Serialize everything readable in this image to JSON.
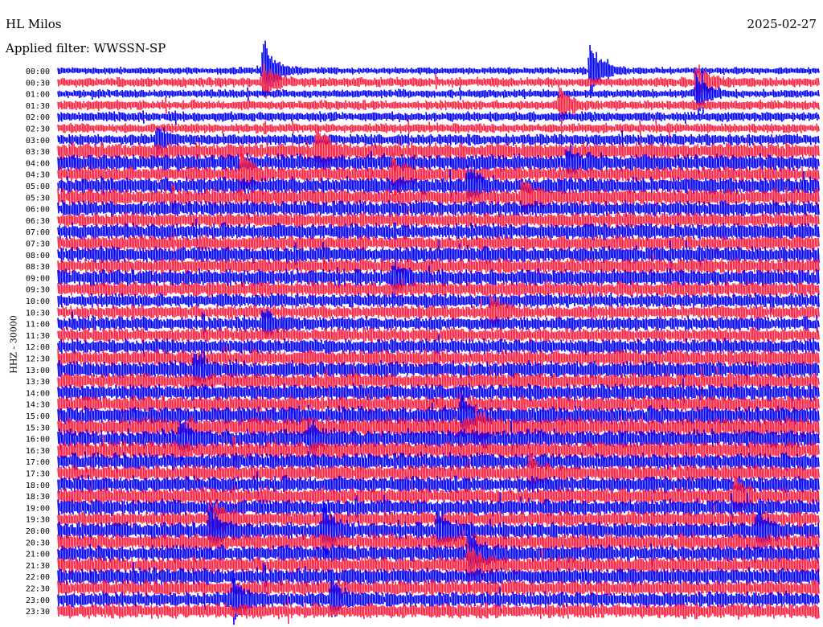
{
  "header": {
    "station": "HL Milos",
    "date": "2025-02-27",
    "filter_label": "Applied filter: WWSSN-SP",
    "channel_label": "HHZ - 30000"
  },
  "colors": {
    "odd_trace": "#0000ff",
    "even_trace": "#ff2040",
    "text": "#000000"
  },
  "chart_data": {
    "type": "line",
    "title": "HL Milos",
    "subtitle": "Applied filter: WWSSN-SP",
    "date": "2025-02-27",
    "ylabel": "HHZ - 30000",
    "xlabel": "",
    "row_labels": [
      "00:00",
      "00:30",
      "01:00",
      "01:30",
      "02:00",
      "02:30",
      "03:00",
      "03:30",
      "04:00",
      "04:30",
      "05:00",
      "05:30",
      "06:00",
      "06:30",
      "07:00",
      "07:30",
      "08:00",
      "08:30",
      "09:00",
      "09:30",
      "10:00",
      "10:30",
      "11:00",
      "11:30",
      "12:00",
      "12:30",
      "13:00",
      "13:30",
      "14:00",
      "14:30",
      "15:00",
      "15:30",
      "16:00",
      "16:30",
      "17:00",
      "17:30",
      "18:00",
      "18:30",
      "19:00",
      "19:30",
      "20:00",
      "20:30",
      "21:00",
      "21:30",
      "22:00",
      "22:30",
      "23:00",
      "23:30"
    ],
    "row_amplitude": [
      5,
      7,
      6,
      7,
      7,
      7,
      8,
      12,
      12,
      11,
      12,
      12,
      11,
      11,
      12,
      11,
      12,
      11,
      12,
      11,
      10,
      10,
      10,
      10,
      11,
      12,
      12,
      12,
      12,
      12,
      13,
      14,
      13,
      13,
      12,
      12,
      12,
      12,
      12,
      11,
      12,
      12,
      12,
      12,
      12,
      11,
      11,
      11
    ],
    "series_colors": [
      "#0000ff",
      "#ff2040"
    ],
    "events": [
      {
        "row": 0,
        "x": 0.27,
        "amp": 45
      },
      {
        "row": 0,
        "x": 0.7,
        "amp": 38
      },
      {
        "row": 1,
        "x": 0.27,
        "amp": 20
      },
      {
        "row": 1,
        "x": 0.84,
        "amp": 25
      },
      {
        "row": 2,
        "x": 0.84,
        "amp": 25
      },
      {
        "row": 3,
        "x": 0.66,
        "amp": 20
      },
      {
        "row": 6,
        "x": 0.13,
        "amp": 18
      },
      {
        "row": 7,
        "x": 0.34,
        "amp": 30
      },
      {
        "row": 8,
        "x": 0.67,
        "amp": 20
      },
      {
        "row": 9,
        "x": 0.24,
        "amp": 25
      },
      {
        "row": 9,
        "x": 0.44,
        "amp": 20
      },
      {
        "row": 10,
        "x": 0.54,
        "amp": 20
      },
      {
        "row": 11,
        "x": 0.61,
        "amp": 20
      },
      {
        "row": 18,
        "x": 0.44,
        "amp": 18
      },
      {
        "row": 21,
        "x": 0.57,
        "amp": 18
      },
      {
        "row": 22,
        "x": 0.27,
        "amp": 18
      },
      {
        "row": 26,
        "x": 0.18,
        "amp": 20
      },
      {
        "row": 30,
        "x": 0.53,
        "amp": 20
      },
      {
        "row": 31,
        "x": 0.55,
        "amp": 18
      },
      {
        "row": 32,
        "x": 0.16,
        "amp": 22
      },
      {
        "row": 32,
        "x": 0.33,
        "amp": 18
      },
      {
        "row": 35,
        "x": 0.62,
        "amp": 18
      },
      {
        "row": 37,
        "x": 0.89,
        "amp": 20
      },
      {
        "row": 39,
        "x": 0.2,
        "amp": 30
      },
      {
        "row": 40,
        "x": 0.2,
        "amp": 30
      },
      {
        "row": 40,
        "x": 0.35,
        "amp": 30
      },
      {
        "row": 40,
        "x": 0.5,
        "amp": 25
      },
      {
        "row": 40,
        "x": 0.92,
        "amp": 28
      },
      {
        "row": 42,
        "x": 0.54,
        "amp": 25
      },
      {
        "row": 43,
        "x": 0.54,
        "amp": 25
      },
      {
        "row": 46,
        "x": 0.23,
        "amp": 30
      },
      {
        "row": 46,
        "x": 0.36,
        "amp": 25
      }
    ]
  }
}
